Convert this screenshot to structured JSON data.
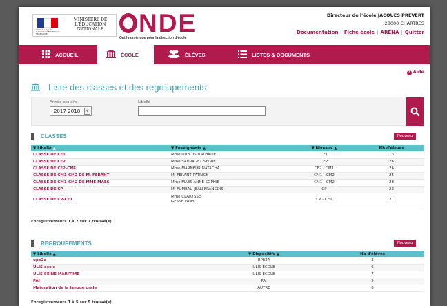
{
  "header": {
    "ministry": "MINISTÈRE DE L'ÉDUCATION NATIONALE",
    "motto": "Liberté • Égalité • Fraternité RÉPUBLIQUE FRANÇAISE",
    "app_name_rest": "NDE",
    "subtitle": "Outil numérique pour la direction d'école",
    "director": "Directeur de l'école JACQUES PREVERT",
    "city": "28000 CHARTRES",
    "links": [
      "Documentation",
      "Fiche école",
      "ARENA",
      "Quitter"
    ]
  },
  "nav": {
    "items": [
      "ACCUEIL",
      "ÉCOLE",
      "ÉLÈVES",
      "LISTES & DOCUMENTS"
    ],
    "active": "ÉCOLE"
  },
  "help": "Aide",
  "page_title": "Liste des classes et des regroupements",
  "search": {
    "year_label": "Année scolaire",
    "year_value": "2017-2018",
    "libelle_label": "Libellé",
    "libelle_value": ""
  },
  "classes": {
    "title": "CLASSES",
    "new_label": "Nouveau",
    "headers": [
      "Libellé",
      "Enseignants",
      "Niveaux",
      "Nb d'élèves"
    ],
    "rows": [
      {
        "libelle": "CLASSE DE CE1",
        "enseignants": "Mme DUBOIS NATHALIE",
        "niveaux": "CE1",
        "nb": "13"
      },
      {
        "libelle": "CLASSE DE CE2",
        "enseignants": "Mme SAUVAGET SYLVIE",
        "niveaux": "CE2",
        "nb": "26"
      },
      {
        "libelle": "CLASSE DE CE2-CM1",
        "enseignants": "Mme MARNEUR NATACHA",
        "niveaux": "CE2 - CM1",
        "nb": "26"
      },
      {
        "libelle": "CLASSE DE CM1-CM2 DE M. FERANT",
        "enseignants": "M. FERANT PATRICK",
        "niveaux": "CM1 - CM2",
        "nb": "25"
      },
      {
        "libelle": "CLASSE DE CM1-CM2 DE MME MAES",
        "enseignants": "Mme MAES ANNE SOPHIE",
        "niveaux": "CM1 - CM2",
        "nb": "28"
      },
      {
        "libelle": "CLASSE DE CP",
        "enseignants": "M. FUMEAU JEAN FRANCOIS",
        "niveaux": "CP",
        "nb": "23"
      },
      {
        "libelle": "CLASSE DE CP-CE1",
        "enseignants": "Mme CLARYSSE GESSE FANY",
        "enseignants2": "",
        "niveaux": "CP - CE1",
        "nb": "21"
      }
    ],
    "count": "Enregistrements 1 à 7 sur 7 trouvé(s)"
  },
  "regroupements": {
    "title": "REGROUPEMENTS",
    "new_label": "Nouveau",
    "headers": [
      "Libellé",
      "Dispositifs",
      "Nb d'élèves"
    ],
    "rows": [
      {
        "libelle": "upe2a",
        "dispositif": "UPE2A",
        "nb": "2"
      },
      {
        "libelle": "ULIS école",
        "dispositif": "ULIS ECOLE",
        "nb": "6"
      },
      {
        "libelle": "ULIS SEINE MARITIME",
        "dispositif": "ULIS ECOLE",
        "nb": "7"
      },
      {
        "libelle": "PAI",
        "dispositif": "PAI",
        "nb": "5"
      },
      {
        "libelle": "Maturation de la langue orale",
        "dispositif": "AUTRE",
        "nb": "6"
      }
    ],
    "count": "Enregistrements 1 à 5 sur 5 trouvé(s)"
  }
}
